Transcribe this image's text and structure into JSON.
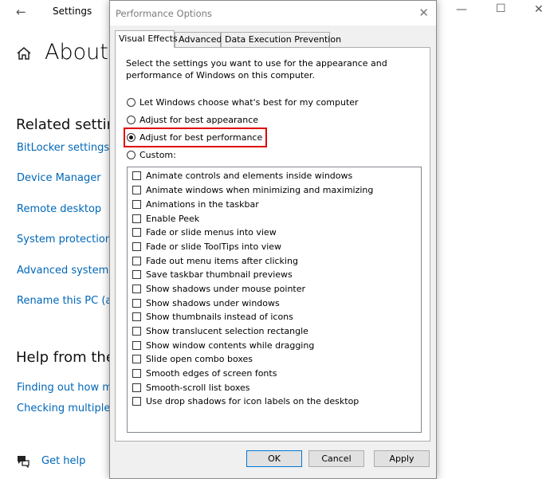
{
  "settings": {
    "title": "Settings",
    "page_title": "About",
    "related_heading": "Related settin",
    "related_links": [
      "BitLocker settings",
      "Device Manager",
      "Remote desktop",
      "System protection",
      "Advanced system s",
      "Rename this PC (ac"
    ],
    "help_heading": "Help from the",
    "help_links": [
      "Finding out how m",
      "Checking multiple"
    ],
    "get_help": "Get help"
  },
  "dialog": {
    "title": "Performance Options",
    "tabs": [
      "Visual Effects",
      "Advanced",
      "Data Execution Prevention"
    ],
    "description": "Select the settings you want to use for the appearance and performance of Windows on this computer.",
    "radio_options": [
      {
        "label": "Let Windows choose what's best for my computer",
        "checked": false
      },
      {
        "label": "Adjust for best appearance",
        "checked": false
      },
      {
        "label": "Adjust for best performance",
        "checked": true
      },
      {
        "label": "Custom:",
        "checked": false
      }
    ],
    "effects": [
      "Animate controls and elements inside windows",
      "Animate windows when minimizing and maximizing",
      "Animations in the taskbar",
      "Enable Peek",
      "Fade or slide menus into view",
      "Fade or slide ToolTips into view",
      "Fade out menu items after clicking",
      "Save taskbar thumbnail previews",
      "Show shadows under mouse pointer",
      "Show shadows under windows",
      "Show thumbnails instead of icons",
      "Show translucent selection rectangle",
      "Show window contents while dragging",
      "Slide open combo boxes",
      "Smooth edges of screen fonts",
      "Smooth-scroll list boxes",
      "Use drop shadows for icon labels on the desktop"
    ],
    "buttons": {
      "ok": "OK",
      "cancel": "Cancel",
      "apply": "Apply"
    }
  },
  "colors": {
    "link": "#0067b8",
    "highlight_border": "#e00000",
    "dialog_background": "#f0f0f0"
  }
}
